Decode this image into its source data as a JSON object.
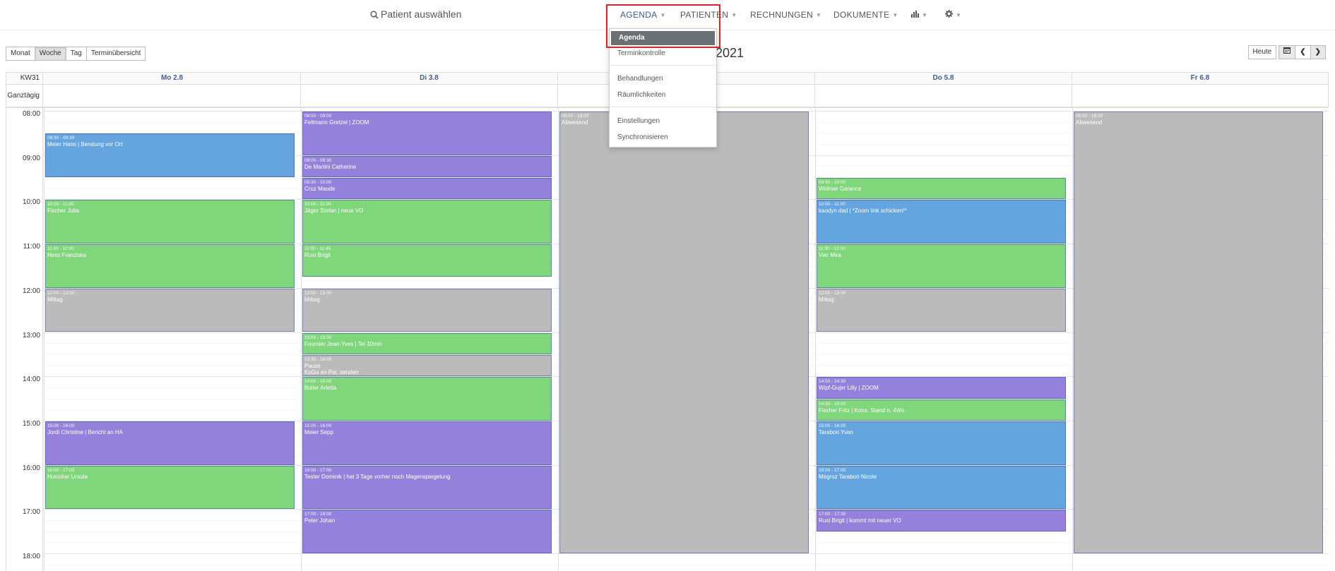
{
  "search": {
    "label": "Patient auswählen"
  },
  "nav": [
    {
      "label": "AGENDA",
      "active": true
    },
    {
      "label": "PATIENTEN"
    },
    {
      "label": "RECHNUNGEN"
    },
    {
      "label": "DOKUMENTE"
    },
    {
      "icon": "bar-chart-icon"
    },
    {
      "icon": "gear-icon"
    }
  ],
  "dropdown": {
    "items": [
      "Agenda",
      "Terminkontrolle",
      "Behandlungen",
      "Räumlichkeiten",
      "Einstellungen",
      "Synchronisieren"
    ],
    "active": "Agenda"
  },
  "views": [
    "Monat",
    "Woche",
    "Tag",
    "Terminübersicht"
  ],
  "active_view": "Woche",
  "calendar_title": "2021",
  "controls": {
    "today": "Heute"
  },
  "week": {
    "label": "KW31",
    "allday_label": "Ganztägig",
    "days": [
      "Mo 2.8",
      "Di 3.8",
      "",
      "Do 5.8",
      "Fr 6.8"
    ],
    "hours": [
      "08:00",
      "09:00",
      "10:00",
      "11:00",
      "12:00",
      "13:00",
      "14:00",
      "15:00",
      "16:00",
      "17:00",
      "18:00"
    ]
  },
  "colors": {
    "green": "#7fd67b",
    "blue": "#64a5e0",
    "purple": "#9381db",
    "gray": "#bbbbbb",
    "accent": "#3e5f99",
    "highlight": "#d9242c"
  },
  "events": [
    {
      "day": 0,
      "start": "08:30",
      "end": "09:30",
      "time": "08:30 - 09:30",
      "title": "Meier Hans | Beratung vor Ort",
      "color": "blue"
    },
    {
      "day": 0,
      "start": "10:00",
      "end": "11:00",
      "time": "10:00 - 11:00",
      "title": "Fischer Julia",
      "color": "green"
    },
    {
      "day": 0,
      "start": "11:00",
      "end": "12:00",
      "time": "11:00 - 12:00",
      "title": "Hess Franziska",
      "color": "green"
    },
    {
      "day": 0,
      "start": "12:00",
      "end": "13:00",
      "time": "12:00 - 13:00",
      "title": "Mittag",
      "color": "gray"
    },
    {
      "day": 0,
      "start": "15:00",
      "end": "16:00",
      "time": "15:00 - 16:00",
      "title": "Jordi Christine | Bericht an HA",
      "color": "purple"
    },
    {
      "day": 0,
      "start": "16:00",
      "end": "17:00",
      "time": "16:00 - 17:00",
      "title": "Hunziker Ursula",
      "color": "green"
    },
    {
      "day": 1,
      "start": "08:00",
      "end": "09:00",
      "time": "08:00 - 09:00",
      "title": "Fellmann Gretzel | ZOOM",
      "color": "purple"
    },
    {
      "day": 1,
      "start": "09:00",
      "end": "09:30",
      "time": "09:00 - 09:30",
      "title": "De Martini Catherine",
      "color": "purple"
    },
    {
      "day": 1,
      "start": "09:30",
      "end": "10:00",
      "time": "09:30 - 10:00",
      "title": "Cruz Maude",
      "color": "purple"
    },
    {
      "day": 1,
      "start": "10:00",
      "end": "11:00",
      "time": "10:00 - 11:00",
      "title": "Jäger Stefan | neue VO",
      "color": "green"
    },
    {
      "day": 1,
      "start": "11:00",
      "end": "11:45",
      "time": "11:00 - 11:45",
      "title": "Rust Brigit",
      "color": "green"
    },
    {
      "day": 1,
      "start": "12:00",
      "end": "13:00",
      "time": "12:00 - 13:00",
      "title": "Mittag",
      "color": "gray"
    },
    {
      "day": 1,
      "start": "13:00",
      "end": "13:30",
      "time": "13:00 - 13:30",
      "title": "Fournier Jean-Yves | Tel 30min",
      "color": "green"
    },
    {
      "day": 1,
      "start": "13:30",
      "end": "14:00",
      "time": "13:30 - 14:00",
      "title": "Pause",
      "note": "KoGu an Pat. senden",
      "color": "gray"
    },
    {
      "day": 1,
      "start": "14:00",
      "end": "15:00",
      "time": "14:00 - 15:00",
      "title": "Boller Arletta",
      "color": "green"
    },
    {
      "day": 1,
      "start": "15:00",
      "end": "16:00",
      "time": "15:00 - 16:00",
      "title": "Meier Sepp",
      "color": "purple"
    },
    {
      "day": 1,
      "start": "16:00",
      "end": "17:00",
      "time": "16:00 - 17:00",
      "title": "Tester Dominik | hat 3 Tage vorher noch Magenspiegelung",
      "color": "purple"
    },
    {
      "day": 1,
      "start": "17:00",
      "end": "18:00",
      "time": "17:00 - 18:00",
      "title": "Peter Johan",
      "color": "purple"
    },
    {
      "day": 2,
      "start": "08:00",
      "end": "18:00",
      "time": "08:00 - 18:00",
      "title": "Abwesend",
      "color": "gray"
    },
    {
      "day": 3,
      "start": "09:30",
      "end": "10:00",
      "time": "09:30 - 10:00",
      "title": "Widmer Garance",
      "color": "green"
    },
    {
      "day": 3,
      "start": "10:00",
      "end": "11:00",
      "time": "10:00 - 11:00",
      "title": "kaodyn dad | *Zoom link schicken!*",
      "color": "blue"
    },
    {
      "day": 3,
      "start": "11:00",
      "end": "12:00",
      "time": "11:00 - 12:00",
      "title": "Vier Mira",
      "color": "green"
    },
    {
      "day": 3,
      "start": "12:00",
      "end": "13:00",
      "time": "12:00 - 13:00",
      "title": "Mittag",
      "color": "gray"
    },
    {
      "day": 3,
      "start": "14:00",
      "end": "14:30",
      "time": "14:00 - 14:30",
      "title": "Wipf-Gujer Lilly | ZOOM",
      "color": "purple"
    },
    {
      "day": 3,
      "start": "14:30",
      "end": "15:00",
      "time": "14:30 - 15:00",
      "title": "Fischer Fritz | Kons: Stand n. 4Wo",
      "color": "green"
    },
    {
      "day": 3,
      "start": "15:00",
      "end": "16:00",
      "time": "15:00 - 16:00",
      "title": "Tarabori Yvan",
      "color": "blue"
    },
    {
      "day": 3,
      "start": "16:00",
      "end": "17:00",
      "time": "16:00 - 17:00",
      "title": "Mégroz Tarabori Nicole",
      "color": "blue"
    },
    {
      "day": 3,
      "start": "17:00",
      "end": "17:30",
      "time": "17:00 - 17:30",
      "title": "Rust Brigit | kommt mit neuer VO",
      "color": "purple"
    },
    {
      "day": 4,
      "start": "08:00",
      "end": "18:00",
      "time": "08:00 - 18:00",
      "title": "Abwesend",
      "color": "gray"
    }
  ]
}
